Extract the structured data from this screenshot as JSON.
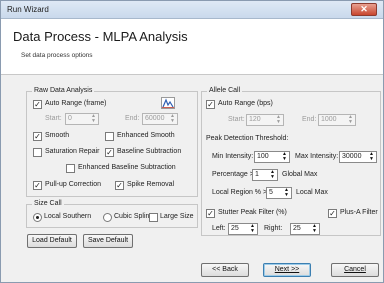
{
  "window": {
    "title": "Run Wizard",
    "close_label": "✕"
  },
  "header": {
    "title": "Data Process - MLPA Analysis",
    "subtitle": "Set data process options"
  },
  "raw": {
    "group_label": "Raw Data Analysis",
    "auto_range_label": "Auto Range (frame)",
    "start_label": "Start:",
    "start_value": "0",
    "end_label": "End:",
    "end_value": "60000",
    "smooth_label": "Smooth",
    "enhanced_smooth_label": "Enhanced Smooth",
    "saturation_label": "Saturation Repair",
    "baseline_label": "Baseline Subtraction",
    "enh_baseline_label": "Enhanced Baseline Subtraction",
    "pullup_label": "Pull-up Correction",
    "spike_label": "Spike Removal"
  },
  "size": {
    "group_label": "Size Call",
    "local_southern": "Local Southern",
    "cubic_spline": "Cubic Spline",
    "large_size": "Large Size"
  },
  "actions": {
    "load_default": "Load Default",
    "save_default": "Save Default"
  },
  "allele": {
    "group_label": "Allele Call",
    "auto_range_label": "Auto Range (bps)",
    "start_label": "Start:",
    "start_value": "120",
    "end_label": "End:",
    "end_value": "1000",
    "peak_label": "Peak Detection Threshold:",
    "min_int_label": "Min Intensity:",
    "min_int_value": "100",
    "max_int_label": "Max Intensity:",
    "max_int_value": "30000",
    "pct_label": "Percentage >",
    "pct_value": "1",
    "global_max_label": "Global Max",
    "local_region_label": "Local Region % >",
    "local_region_value": "5",
    "local_max_label": "Local Max",
    "stutter_label": "Stutter Peak Filter (%)",
    "plusa_label": "Plus-A Filter",
    "left_label": "Left:",
    "left_value": "25",
    "right_label": "Right:",
    "right_value": "25"
  },
  "nav": {
    "back": "<< Back",
    "next": "Next >>",
    "cancel": "Cancel"
  },
  "colors": {
    "title_bar": "#c9d9ec",
    "close": "#c8462f",
    "dialog_bg": "#f0f0f0"
  }
}
